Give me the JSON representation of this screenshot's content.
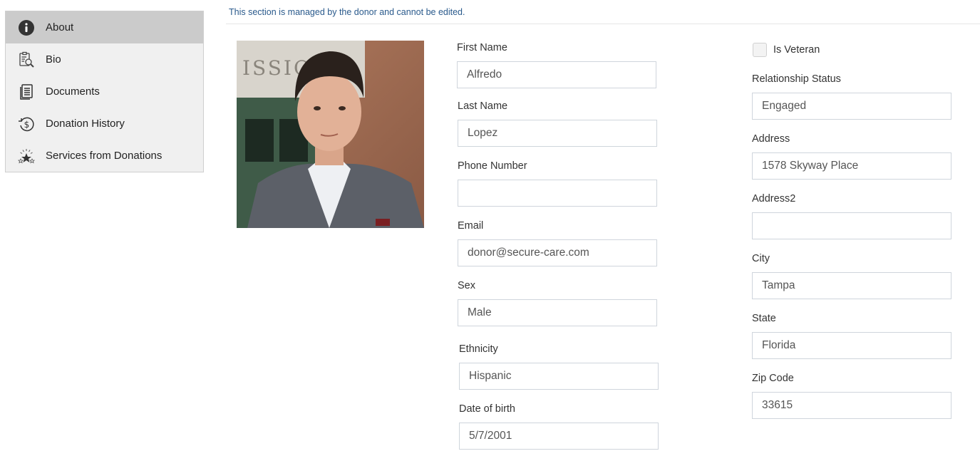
{
  "sidebar": {
    "items": [
      {
        "label": "About",
        "icon": "info-icon",
        "active": true
      },
      {
        "label": "Bio",
        "icon": "clipboard-search-icon",
        "active": false
      },
      {
        "label": "Documents",
        "icon": "documents-icon",
        "active": false
      },
      {
        "label": "Donation History",
        "icon": "dollar-history-icon",
        "active": false
      },
      {
        "label": "Services from Donations",
        "icon": "stars-icon",
        "active": false
      }
    ]
  },
  "notice": "This section is managed by the donor and cannot be edited.",
  "photo": {
    "alt": "Donor profile photo"
  },
  "form": {
    "first_name": {
      "label": "First Name",
      "value": "Alfredo"
    },
    "last_name": {
      "label": "Last Name",
      "value": "Lopez"
    },
    "phone": {
      "label": "Phone Number",
      "value": ""
    },
    "email": {
      "label": "Email",
      "value": "donor@secure-care.com"
    },
    "sex": {
      "label": "Sex",
      "value": "Male"
    },
    "ethnicity": {
      "label": "Ethnicity",
      "value": "Hispanic"
    },
    "dob": {
      "label": "Date of birth",
      "value": "5/7/2001"
    },
    "is_veteran": {
      "label": "Is Veteran",
      "checked": false
    },
    "relationship": {
      "label": "Relationship Status",
      "value": "Engaged"
    },
    "address": {
      "label": "Address",
      "value": "1578 Skyway Place"
    },
    "address2": {
      "label": "Address2",
      "value": ""
    },
    "city": {
      "label": "City",
      "value": "Tampa"
    },
    "state": {
      "label": "State",
      "value": "Florida"
    },
    "zip": {
      "label": "Zip Code",
      "value": "33615"
    }
  }
}
